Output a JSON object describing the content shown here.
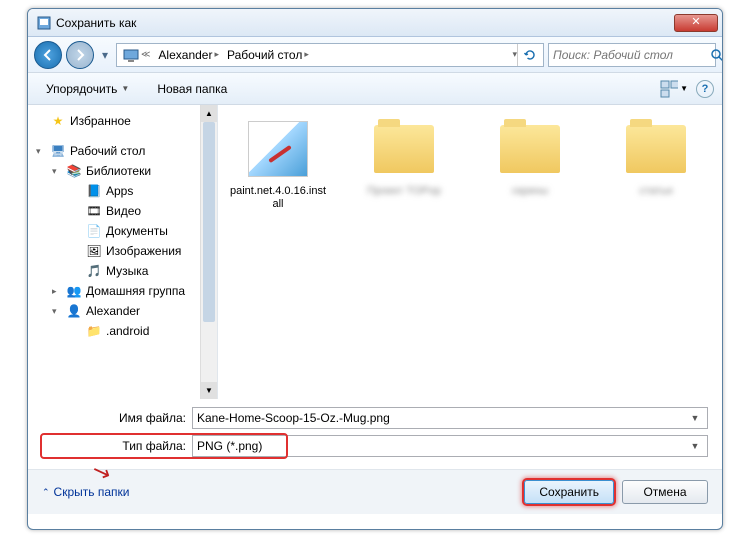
{
  "window": {
    "title": "Сохранить как"
  },
  "nav": {
    "breadcrumb": [
      {
        "label": "Alexander"
      },
      {
        "label": "Рабочий стол"
      }
    ],
    "search_placeholder": "Поиск: Рабочий стол"
  },
  "toolbar": {
    "organize": "Упорядочить",
    "new_folder": "Новая папка"
  },
  "sidebar": {
    "favorites": "Избранное",
    "desktop": "Рабочий стол",
    "libraries": "Библиотеки",
    "lib_items": [
      "Apps",
      "Видео",
      "Документы",
      "Изображения",
      "Музыка"
    ],
    "homegroup": "Домашняя группа",
    "user": "Alexander",
    "user_items": [
      ".android"
    ]
  },
  "files": [
    {
      "name": "paint.net.4.0.16.install",
      "type": "paint"
    },
    {
      "name": "Проект TOPop",
      "type": "folder",
      "blur": true
    },
    {
      "name": "скрины",
      "type": "folder",
      "blur": true
    },
    {
      "name": "статьи",
      "type": "folder",
      "blur": true
    }
  ],
  "form": {
    "filename_label": "Имя файла:",
    "filename_value": "Kane-Home-Scoop-15-Oz.-Mug.png",
    "filetype_label": "Тип файла:",
    "filetype_value": "PNG (*.png)"
  },
  "footer": {
    "hide_folders": "Скрыть папки",
    "save": "Сохранить",
    "cancel": "Отмена"
  }
}
